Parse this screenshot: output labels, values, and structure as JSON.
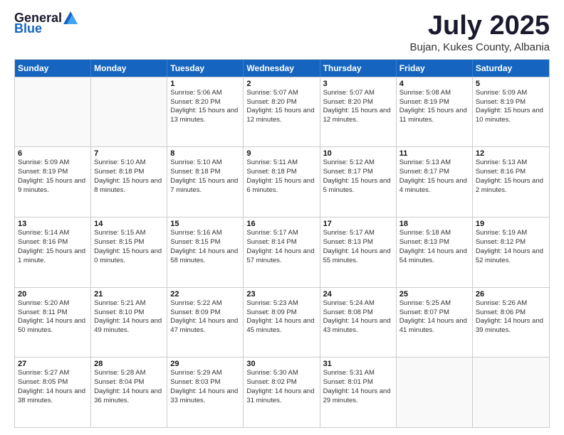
{
  "header": {
    "logo_general": "General",
    "logo_blue": "Blue",
    "month": "July 2025",
    "location": "Bujan, Kukes County, Albania"
  },
  "days_of_week": [
    "Sunday",
    "Monday",
    "Tuesday",
    "Wednesday",
    "Thursday",
    "Friday",
    "Saturday"
  ],
  "weeks": [
    [
      {
        "day": "",
        "sunrise": "",
        "sunset": "",
        "daylight": ""
      },
      {
        "day": "",
        "sunrise": "",
        "sunset": "",
        "daylight": ""
      },
      {
        "day": "1",
        "sunrise": "Sunrise: 5:06 AM",
        "sunset": "Sunset: 8:20 PM",
        "daylight": "Daylight: 15 hours and 13 minutes."
      },
      {
        "day": "2",
        "sunrise": "Sunrise: 5:07 AM",
        "sunset": "Sunset: 8:20 PM",
        "daylight": "Daylight: 15 hours and 12 minutes."
      },
      {
        "day": "3",
        "sunrise": "Sunrise: 5:07 AM",
        "sunset": "Sunset: 8:20 PM",
        "daylight": "Daylight: 15 hours and 12 minutes."
      },
      {
        "day": "4",
        "sunrise": "Sunrise: 5:08 AM",
        "sunset": "Sunset: 8:19 PM",
        "daylight": "Daylight: 15 hours and 11 minutes."
      },
      {
        "day": "5",
        "sunrise": "Sunrise: 5:09 AM",
        "sunset": "Sunset: 8:19 PM",
        "daylight": "Daylight: 15 hours and 10 minutes."
      }
    ],
    [
      {
        "day": "6",
        "sunrise": "Sunrise: 5:09 AM",
        "sunset": "Sunset: 8:19 PM",
        "daylight": "Daylight: 15 hours and 9 minutes."
      },
      {
        "day": "7",
        "sunrise": "Sunrise: 5:10 AM",
        "sunset": "Sunset: 8:18 PM",
        "daylight": "Daylight: 15 hours and 8 minutes."
      },
      {
        "day": "8",
        "sunrise": "Sunrise: 5:10 AM",
        "sunset": "Sunset: 8:18 PM",
        "daylight": "Daylight: 15 hours and 7 minutes."
      },
      {
        "day": "9",
        "sunrise": "Sunrise: 5:11 AM",
        "sunset": "Sunset: 8:18 PM",
        "daylight": "Daylight: 15 hours and 6 minutes."
      },
      {
        "day": "10",
        "sunrise": "Sunrise: 5:12 AM",
        "sunset": "Sunset: 8:17 PM",
        "daylight": "Daylight: 15 hours and 5 minutes."
      },
      {
        "day": "11",
        "sunrise": "Sunrise: 5:13 AM",
        "sunset": "Sunset: 8:17 PM",
        "daylight": "Daylight: 15 hours and 4 minutes."
      },
      {
        "day": "12",
        "sunrise": "Sunrise: 5:13 AM",
        "sunset": "Sunset: 8:16 PM",
        "daylight": "Daylight: 15 hours and 2 minutes."
      }
    ],
    [
      {
        "day": "13",
        "sunrise": "Sunrise: 5:14 AM",
        "sunset": "Sunset: 8:16 PM",
        "daylight": "Daylight: 15 hours and 1 minute."
      },
      {
        "day": "14",
        "sunrise": "Sunrise: 5:15 AM",
        "sunset": "Sunset: 8:15 PM",
        "daylight": "Daylight: 15 hours and 0 minutes."
      },
      {
        "day": "15",
        "sunrise": "Sunrise: 5:16 AM",
        "sunset": "Sunset: 8:15 PM",
        "daylight": "Daylight: 14 hours and 58 minutes."
      },
      {
        "day": "16",
        "sunrise": "Sunrise: 5:17 AM",
        "sunset": "Sunset: 8:14 PM",
        "daylight": "Daylight: 14 hours and 57 minutes."
      },
      {
        "day": "17",
        "sunrise": "Sunrise: 5:17 AM",
        "sunset": "Sunset: 8:13 PM",
        "daylight": "Daylight: 14 hours and 55 minutes."
      },
      {
        "day": "18",
        "sunrise": "Sunrise: 5:18 AM",
        "sunset": "Sunset: 8:13 PM",
        "daylight": "Daylight: 14 hours and 54 minutes."
      },
      {
        "day": "19",
        "sunrise": "Sunrise: 5:19 AM",
        "sunset": "Sunset: 8:12 PM",
        "daylight": "Daylight: 14 hours and 52 minutes."
      }
    ],
    [
      {
        "day": "20",
        "sunrise": "Sunrise: 5:20 AM",
        "sunset": "Sunset: 8:11 PM",
        "daylight": "Daylight: 14 hours and 50 minutes."
      },
      {
        "day": "21",
        "sunrise": "Sunrise: 5:21 AM",
        "sunset": "Sunset: 8:10 PM",
        "daylight": "Daylight: 14 hours and 49 minutes."
      },
      {
        "day": "22",
        "sunrise": "Sunrise: 5:22 AM",
        "sunset": "Sunset: 8:09 PM",
        "daylight": "Daylight: 14 hours and 47 minutes."
      },
      {
        "day": "23",
        "sunrise": "Sunrise: 5:23 AM",
        "sunset": "Sunset: 8:09 PM",
        "daylight": "Daylight: 14 hours and 45 minutes."
      },
      {
        "day": "24",
        "sunrise": "Sunrise: 5:24 AM",
        "sunset": "Sunset: 8:08 PM",
        "daylight": "Daylight: 14 hours and 43 minutes."
      },
      {
        "day": "25",
        "sunrise": "Sunrise: 5:25 AM",
        "sunset": "Sunset: 8:07 PM",
        "daylight": "Daylight: 14 hours and 41 minutes."
      },
      {
        "day": "26",
        "sunrise": "Sunrise: 5:26 AM",
        "sunset": "Sunset: 8:06 PM",
        "daylight": "Daylight: 14 hours and 39 minutes."
      }
    ],
    [
      {
        "day": "27",
        "sunrise": "Sunrise: 5:27 AM",
        "sunset": "Sunset: 8:05 PM",
        "daylight": "Daylight: 14 hours and 38 minutes."
      },
      {
        "day": "28",
        "sunrise": "Sunrise: 5:28 AM",
        "sunset": "Sunset: 8:04 PM",
        "daylight": "Daylight: 14 hours and 36 minutes."
      },
      {
        "day": "29",
        "sunrise": "Sunrise: 5:29 AM",
        "sunset": "Sunset: 8:03 PM",
        "daylight": "Daylight: 14 hours and 33 minutes."
      },
      {
        "day": "30",
        "sunrise": "Sunrise: 5:30 AM",
        "sunset": "Sunset: 8:02 PM",
        "daylight": "Daylight: 14 hours and 31 minutes."
      },
      {
        "day": "31",
        "sunrise": "Sunrise: 5:31 AM",
        "sunset": "Sunset: 8:01 PM",
        "daylight": "Daylight: 14 hours and 29 minutes."
      },
      {
        "day": "",
        "sunrise": "",
        "sunset": "",
        "daylight": ""
      },
      {
        "day": "",
        "sunrise": "",
        "sunset": "",
        "daylight": ""
      }
    ]
  ]
}
